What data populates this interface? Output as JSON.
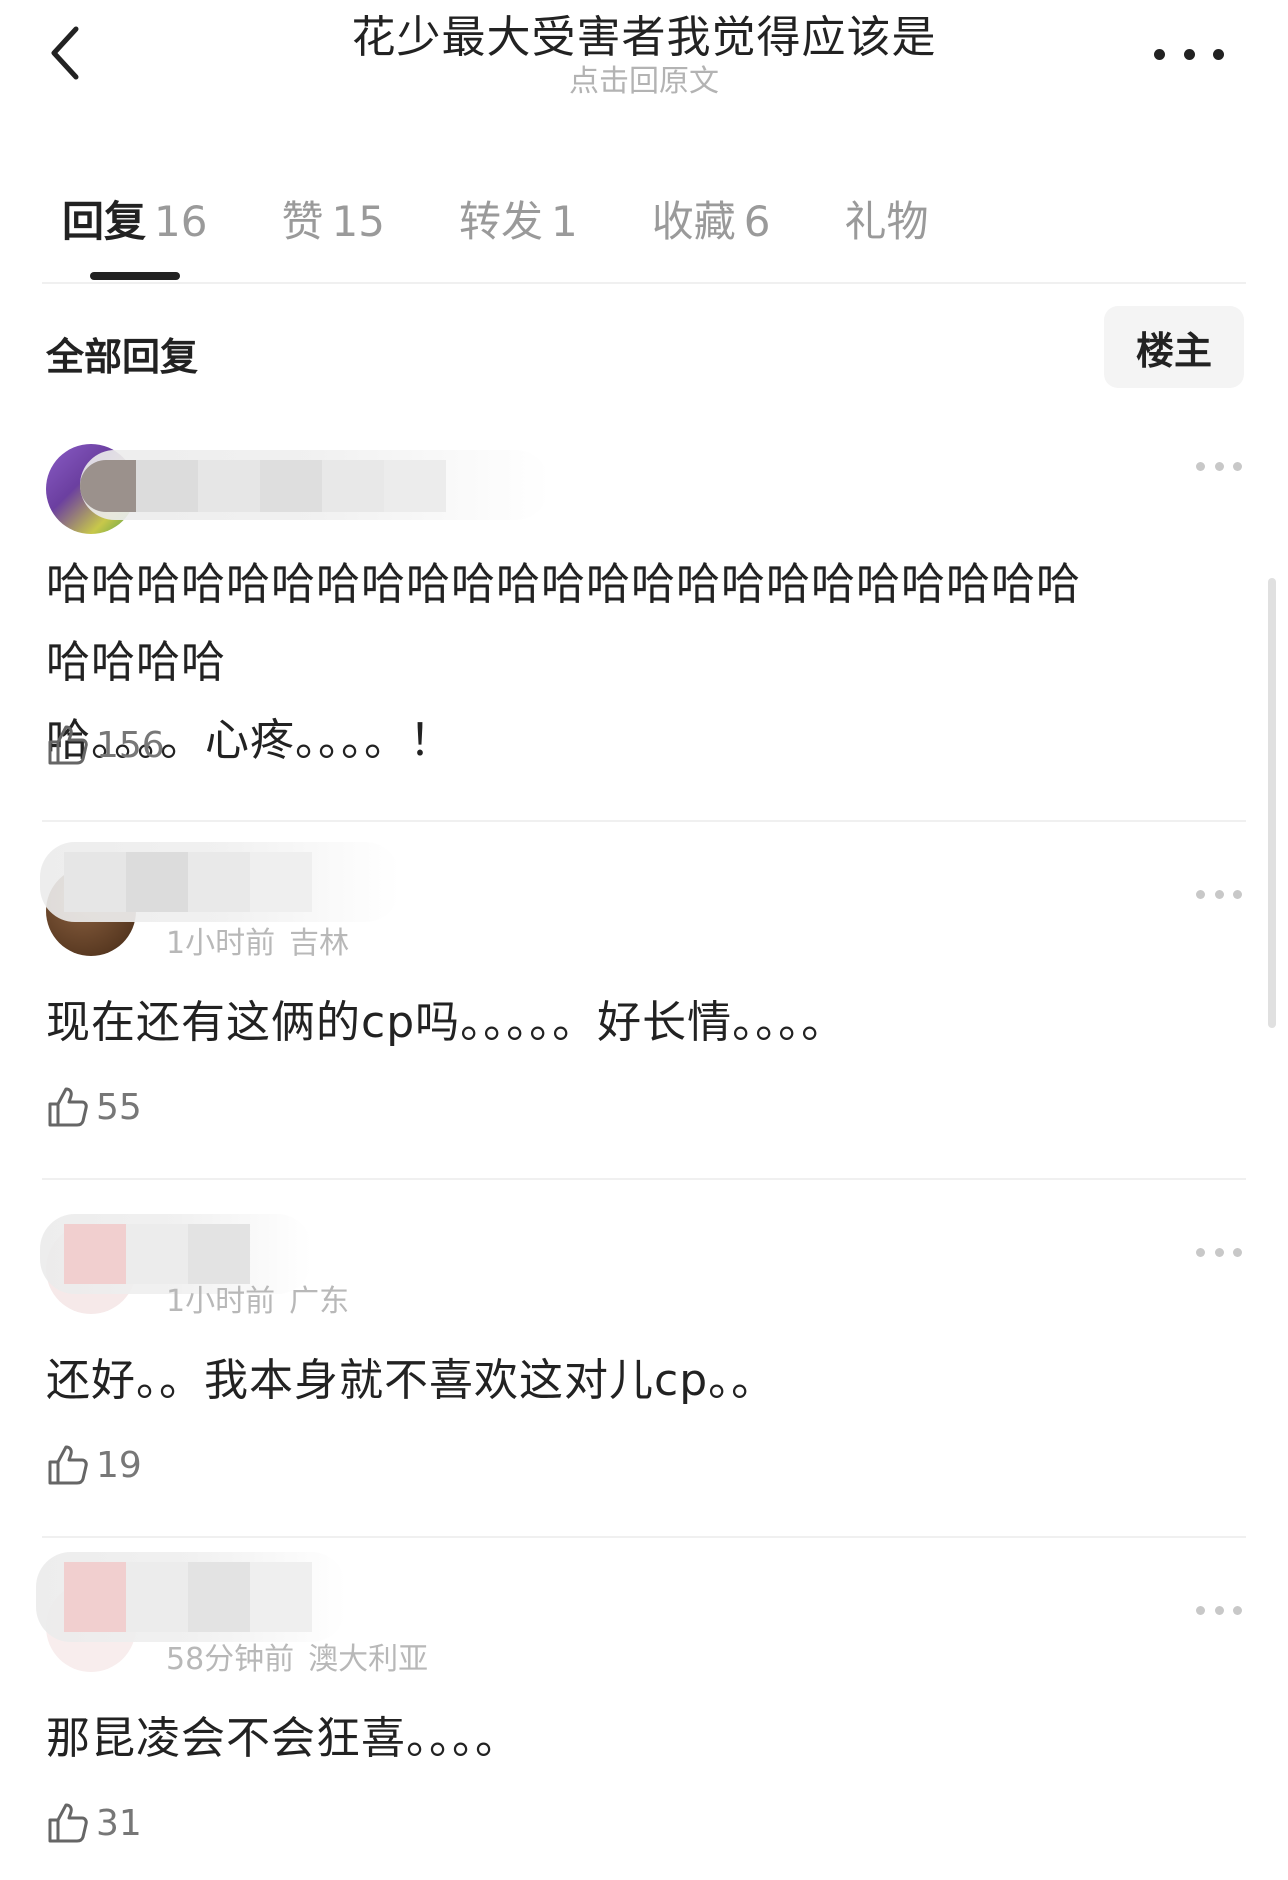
{
  "header": {
    "title": "花少最大受害者我觉得应该是",
    "subtitle": "点击回原文",
    "back_icon": "chevron-left-icon",
    "more_icon": "more-dots-icon"
  },
  "tabs": [
    {
      "label": "回复",
      "count": "16",
      "active": true
    },
    {
      "label": "赞",
      "count": "15",
      "active": false
    },
    {
      "label": "转发",
      "count": "1",
      "active": false
    },
    {
      "label": "收藏",
      "count": "6",
      "active": false
    },
    {
      "label": "礼物",
      "count": "",
      "active": false
    }
  ],
  "filter": {
    "section_title": "全部回复",
    "op_button": "楼主"
  },
  "comments": [
    {
      "time": "",
      "location": "",
      "text": "哈哈哈哈哈哈哈哈哈哈哈哈哈哈哈哈哈哈哈哈哈哈哈哈哈哈哈哈。。。。心疼。。。。！",
      "line1": "哈哈哈哈哈哈哈哈哈哈哈哈哈哈哈哈哈哈哈哈哈哈哈哈哈哈哈",
      "line2": "哈。。。。心疼。。。。！",
      "likes": "156"
    },
    {
      "time": "1小时前",
      "location": "吉林",
      "text": "现在还有这俩的cp吗。。。。。好长情。。。。",
      "likes": "55"
    },
    {
      "time": "1小时前",
      "location": "广东",
      "text": "还好。。我本身就不喜欢这对儿cp。。",
      "likes": "19"
    },
    {
      "time": "58分钟前",
      "location": "澳大利亚",
      "text": "那昆凌会不会狂喜。。。。",
      "likes": "31"
    }
  ],
  "colors": {
    "text_primary": "#222222",
    "text_secondary": "#9a9a9a",
    "meta_gray": "#b8b8b8",
    "divider": "#f0f0f0"
  }
}
